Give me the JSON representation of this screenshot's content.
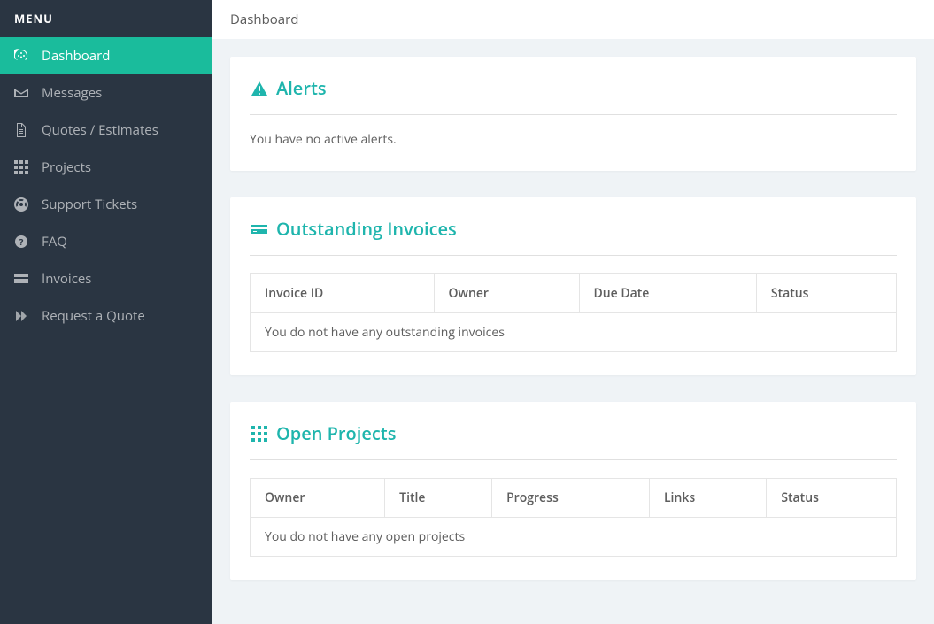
{
  "sidebar": {
    "header": "MENU",
    "items": [
      {
        "label": "Dashboard"
      },
      {
        "label": "Messages"
      },
      {
        "label": "Quotes / Estimates"
      },
      {
        "label": "Projects"
      },
      {
        "label": "Support Tickets"
      },
      {
        "label": "FAQ"
      },
      {
        "label": "Invoices"
      },
      {
        "label": "Request a Quote"
      }
    ]
  },
  "header": {
    "title": "Dashboard"
  },
  "alerts": {
    "title": "Alerts",
    "empty": "You have no active alerts."
  },
  "invoices": {
    "title": "Outstanding Invoices",
    "columns": {
      "c1": "Invoice ID",
      "c2": "Owner",
      "c3": "Due Date",
      "c4": "Status"
    },
    "empty": "You do not have any outstanding invoices"
  },
  "projects": {
    "title": "Open Projects",
    "columns": {
      "c1": "Owner",
      "c2": "Title",
      "c3": "Progress",
      "c4": "Links",
      "c5": "Status"
    },
    "empty": "You do not have any open projects"
  }
}
